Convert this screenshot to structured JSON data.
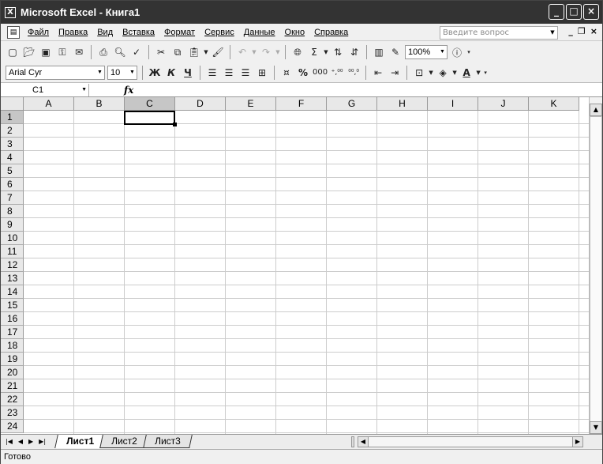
{
  "window": {
    "title": "Microsoft Excel - Книга1",
    "app_icon": "excel-icon",
    "min": "_",
    "max": "□",
    "close": "×"
  },
  "menu": {
    "items": [
      "Файл",
      "Правка",
      "Вид",
      "Вставка",
      "Формат",
      "Сервис",
      "Данные",
      "Окно",
      "Справка"
    ],
    "ask_placeholder": "Введите вопрос",
    "doc_min": "_",
    "doc_restore": "❐",
    "doc_close": "×"
  },
  "toolbar": {
    "zoom": "100%",
    "font_name": "Arial Cyr",
    "font_size": "10",
    "bold": "Ж",
    "italic": "К",
    "underline": "Ч",
    "sigma": "Σ",
    "percent": "%",
    "thousands": "000",
    "inc_decimal": "⁺,⁰⁰",
    "dec_decimal": "⁰⁰,⁰",
    "font_color_letter": "A"
  },
  "formula_bar": {
    "name_box": "C1",
    "fx": "fx",
    "value": ""
  },
  "grid": {
    "columns": [
      "A",
      "B",
      "C",
      "D",
      "E",
      "F",
      "G",
      "H",
      "I",
      "J",
      "K"
    ],
    "rows": [
      "1",
      "2",
      "3",
      "4",
      "5",
      "6",
      "7",
      "8",
      "9",
      "10",
      "11",
      "12",
      "13",
      "14",
      "15",
      "16",
      "17",
      "18",
      "19",
      "20",
      "21",
      "22",
      "23",
      "24"
    ],
    "selected_column": "C",
    "selected_row": "1"
  },
  "sheets": {
    "tabs": [
      "Лист1",
      "Лист2",
      "Лист3"
    ],
    "active": "Лист1"
  },
  "status": {
    "text": "Готово"
  }
}
